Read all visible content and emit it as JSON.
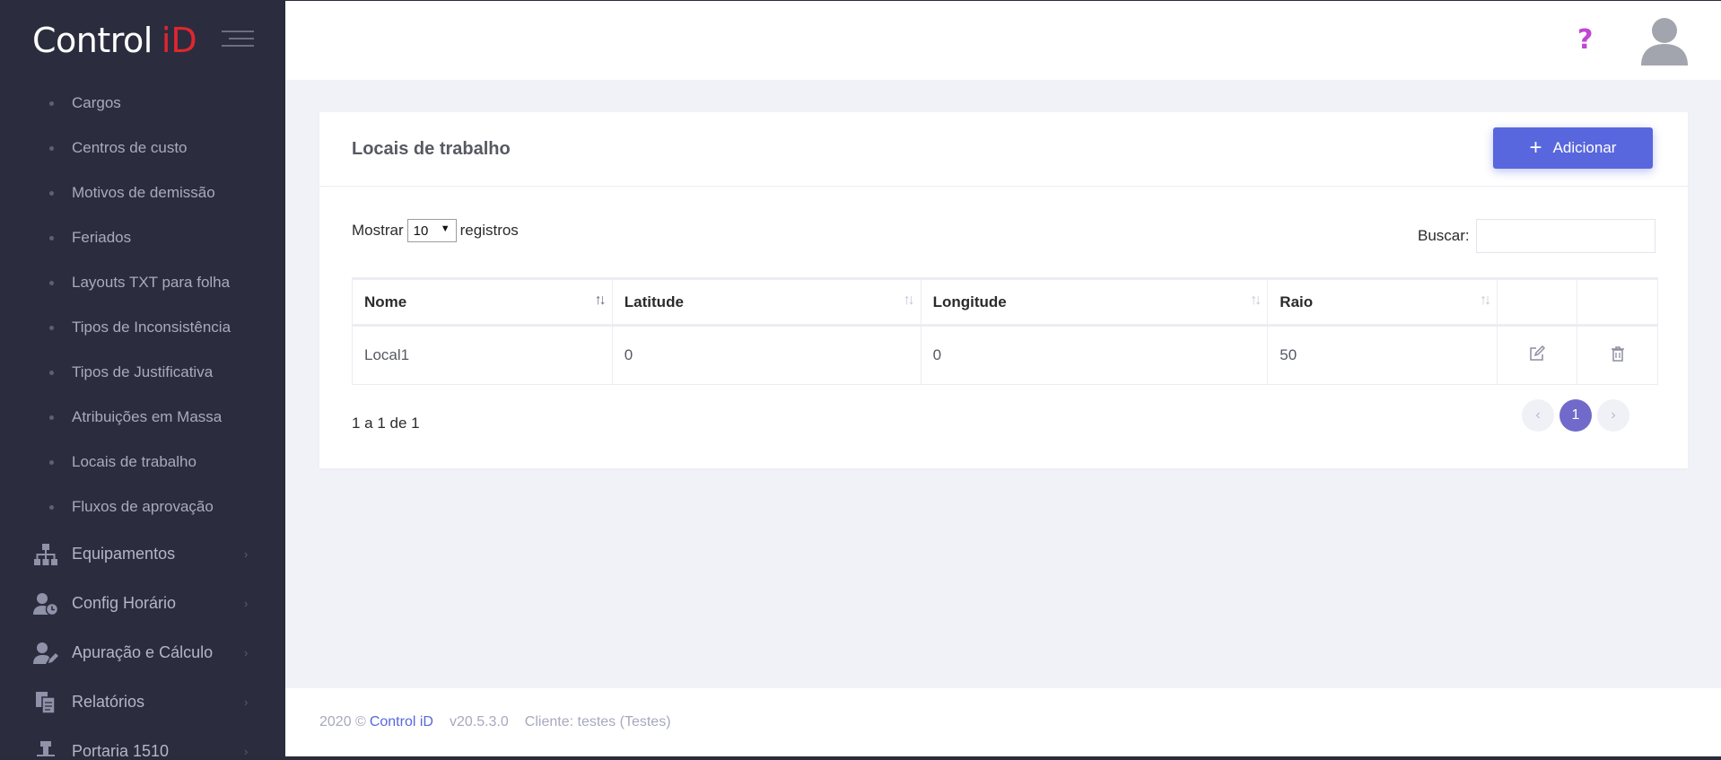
{
  "brand": {
    "name": "Control",
    "accent": "iD"
  },
  "sidebar": {
    "sub_items": [
      {
        "label": "Cargos"
      },
      {
        "label": "Centros de custo"
      },
      {
        "label": "Motivos de demissão"
      },
      {
        "label": "Feriados"
      },
      {
        "label": "Layouts TXT para folha"
      },
      {
        "label": "Tipos de Inconsistência"
      },
      {
        "label": "Tipos de Justificativa"
      },
      {
        "label": "Atribuições em Massa"
      },
      {
        "label": "Locais de trabalho"
      },
      {
        "label": "Fluxos de aprovação"
      }
    ],
    "main_items": [
      {
        "label": "Equipamentos",
        "icon": "sitemap-icon"
      },
      {
        "label": "Config Horário",
        "icon": "user-clock-icon"
      },
      {
        "label": "Apuração e Cálculo",
        "icon": "user-edit-icon"
      },
      {
        "label": "Relatórios",
        "icon": "documents-icon"
      },
      {
        "label": "Portaria 1510",
        "icon": "stamp-icon"
      }
    ]
  },
  "topbar": {
    "help": "?"
  },
  "card": {
    "title": "Locais de trabalho",
    "add_label": "Adicionar",
    "show_label": "Mostrar",
    "page_size": "10",
    "records_label": "registros",
    "search_label": "Buscar:",
    "search_value": ""
  },
  "table": {
    "columns": [
      "Nome",
      "Latitude",
      "Longitude",
      "Raio"
    ],
    "rows": [
      {
        "nome": "Local1",
        "latitude": "0",
        "longitude": "0",
        "raio": "50"
      }
    ]
  },
  "pagination": {
    "info": "1 a 1 de 1",
    "prev": "‹",
    "current": "1",
    "next": "›"
  },
  "footer": {
    "copyright": "2020 ©",
    "company": "Control iD",
    "version": "v20.5.3.0",
    "client": "Cliente: testes (Testes)"
  },
  "colors": {
    "sidebar": "#2b2d3e",
    "primary": "#5867dd",
    "page_active": "#716aca",
    "brand_accent": "#e0262e",
    "help": "#c145d4"
  }
}
